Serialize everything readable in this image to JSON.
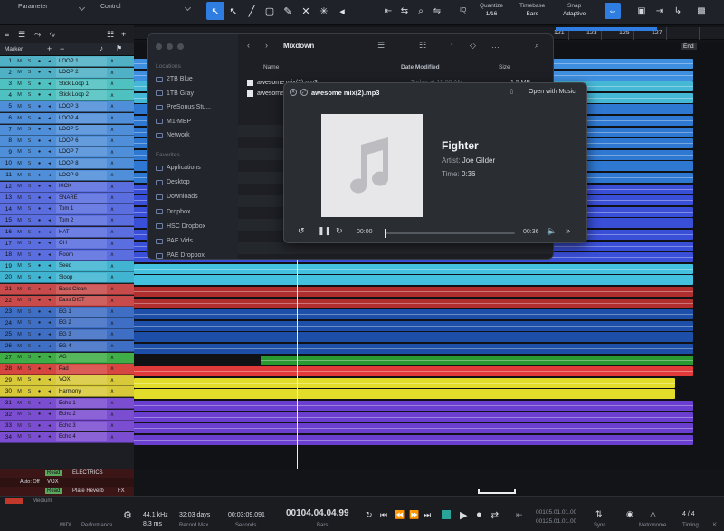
{
  "toolbar": {
    "parameter_label": "Parameter",
    "control_label": "Control",
    "quantize_label": "Quantize",
    "quantize_value": "1/16",
    "timebase_label": "Timebase",
    "timebase_value": "Bars",
    "snap_label": "Snap",
    "snap_value": "Adaptive",
    "iq_label": "IQ"
  },
  "ruler": {
    "numbers": [
      "121",
      "123",
      "125",
      "127"
    ],
    "end_label": "End"
  },
  "track_header": {
    "marker_label": "Marker"
  },
  "tracks": [
    {
      "num": "1",
      "name": "LOOP 1",
      "color": "#4fb0c6",
      "clip": "#3f8fe0"
    },
    {
      "num": "2",
      "name": "LOOP 2",
      "color": "#4fb0c6",
      "clip": "#3f8fe0"
    },
    {
      "num": "3",
      "name": "Stick Loop 1",
      "color": "#4fc1c1",
      "clip": "#45b8d6"
    },
    {
      "num": "4",
      "name": "Stick Loop 2",
      "color": "#4fc1c1",
      "clip": "#45b8d6"
    },
    {
      "num": "5",
      "name": "LOOP 3",
      "color": "#4f8fd9",
      "clip": "#2f78d2"
    },
    {
      "num": "6",
      "name": "LOOP 4",
      "color": "#4f8fd9",
      "clip": "#2f78d2"
    },
    {
      "num": "7",
      "name": "LOOP 5",
      "color": "#4f8fd9",
      "clip": "#2f78d2"
    },
    {
      "num": "8",
      "name": "LOOP 6",
      "color": "#4f8fd9",
      "clip": "#2f78d2"
    },
    {
      "num": "9",
      "name": "LOOP 7",
      "color": "#4f8fd9",
      "clip": "#2f78d2"
    },
    {
      "num": "10",
      "name": "LOOP 8",
      "color": "#4f8fd9",
      "clip": "#2f78d2"
    },
    {
      "num": "11",
      "name": "LOOP 9",
      "color": "#4f8fd9",
      "clip": "#2f78d2"
    },
    {
      "num": "12",
      "name": "KICK",
      "color": "#5b6ee0",
      "clip": "#3a4fd8"
    },
    {
      "num": "13",
      "name": "SNARE",
      "color": "#5b6ee0",
      "clip": "#3a4fd8"
    },
    {
      "num": "14",
      "name": "Tom 1",
      "color": "#5b6ee0",
      "clip": "#3a4fd8"
    },
    {
      "num": "15",
      "name": "Tom 2",
      "color": "#5b6ee0",
      "clip": "#3a4fd8"
    },
    {
      "num": "16",
      "name": "HAT",
      "color": "#5b6ee0",
      "clip": "#3a4fd8"
    },
    {
      "num": "17",
      "name": "OH",
      "color": "#5b6ee0",
      "clip": "#3a4fd8"
    },
    {
      "num": "18",
      "name": "Room",
      "color": "#5b6ee0",
      "clip": "#3a4fd8"
    },
    {
      "num": "19",
      "name": "Seed",
      "color": "#41b4d2",
      "clip": "#43c1de"
    },
    {
      "num": "20",
      "name": "Sloop",
      "color": "#41b4d2",
      "clip": "#43c1de"
    },
    {
      "num": "21",
      "name": "Bass Clean",
      "color": "#c94a4a",
      "clip": "#b12e2e"
    },
    {
      "num": "22",
      "name": "Bass DIST",
      "color": "#c94a4a",
      "clip": "#b12e2e"
    },
    {
      "num": "23",
      "name": "EG 1",
      "color": "#3f6fc4",
      "clip": "#1e4fa8"
    },
    {
      "num": "24",
      "name": "EG 2",
      "color": "#3f6fc4",
      "clip": "#1e4fa8"
    },
    {
      "num": "25",
      "name": "EG 3",
      "color": "#3f6fc4",
      "clip": "#1e4fa8"
    },
    {
      "num": "26",
      "name": "EG 4",
      "color": "#3f6fc4",
      "clip": "#1e4fa8"
    },
    {
      "num": "27",
      "name": "AG",
      "color": "#3fae46",
      "clip": "#2a9a30"
    },
    {
      "num": "28",
      "name": "Pad",
      "color": "#d6453f",
      "clip": "#e03a3a"
    },
    {
      "num": "29",
      "name": "VOX",
      "color": "#d8c93a",
      "clip": "#e2dc2a"
    },
    {
      "num": "30",
      "name": "Harmony",
      "color": "#d8c93a",
      "clip": "#e2dc2a"
    },
    {
      "num": "31",
      "name": "Echo 1",
      "color": "#7b4ed1",
      "clip": "#6a3fcf"
    },
    {
      "num": "32",
      "name": "Echo 2",
      "color": "#7b4ed1",
      "clip": "#6a3fcf"
    },
    {
      "num": "33",
      "name": "Echo 3",
      "color": "#7b4ed1",
      "clip": "#6a3fcf"
    },
    {
      "num": "34",
      "name": "Echo 4",
      "color": "#7b4ed1",
      "clip": "#6a3fcf"
    }
  ],
  "fx_tracks": [
    {
      "name": "ELECTRICS",
      "read": "Read"
    },
    {
      "name": "VOX",
      "auto": "Auto: Off"
    },
    {
      "name": "Plate Reverb",
      "read": "Read",
      "fx": "FX"
    }
  ],
  "finder": {
    "title": "Mixdown",
    "locations_header": "Locations",
    "locations": [
      "2TB Blue",
      "1TB Gray",
      "PreSonus Stu...",
      "M1-MBP",
      "Network"
    ],
    "favorites_header": "Favorites",
    "favorites": [
      "Applications",
      "Desktop",
      "Downloads",
      "Dropbox",
      "HSC Dropbox",
      "PAE Vids",
      "PAE Dropbox"
    ],
    "col_name": "Name",
    "col_date": "Date Modified",
    "col_size": "Size",
    "files": [
      {
        "name": "awesome mix(2).mp3",
        "date": "Today at 11:00 AM",
        "size": "1.5 MB"
      },
      {
        "name": "awesome mix.mp3",
        "date": "",
        "size": ""
      }
    ]
  },
  "player": {
    "file_title": "awesome mix(2).mp3",
    "open_with": "Open with Music",
    "song_title": "Fighter",
    "artist_label": "Artist:",
    "artist": "Joe Gilder",
    "time_label": "Time:",
    "time": "0:36",
    "current_time": "00:00",
    "duration": "00:36",
    "progress": 0.0
  },
  "bottom": {
    "midi_label": "MIDI",
    "performance_label": "Performance",
    "sample_rate": "44.1 kHz",
    "latency": "8.3 ms",
    "record_days": "32:03 days",
    "record_max_label": "Record Max",
    "seconds_value": "00:03:09.091",
    "seconds_label": "Seconds",
    "bars_value": "00104.04.04.99",
    "bars_label": "Bars",
    "loop_start": "00105.01.01.00",
    "loop_end": "00125.01.01.00",
    "sync_label": "Sync",
    "metronome_label": "Metronome",
    "time_sig": "4 / 4",
    "timing_label": "Timing",
    "medium_label": "Medium"
  },
  "colors": {
    "accent": "#2f7de1",
    "vox_yellow": "#e2dc2a",
    "bass_red": "#b12e2e"
  }
}
